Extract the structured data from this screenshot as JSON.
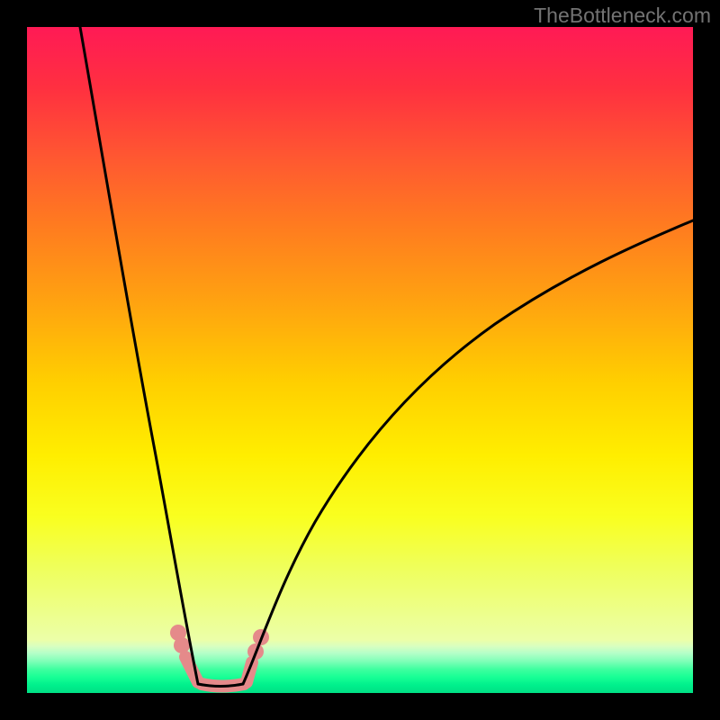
{
  "watermark": "TheBottleneck.com",
  "chart_data": {
    "type": "line",
    "title": "",
    "xlabel": "",
    "ylabel": "",
    "xlim": [
      0,
      100
    ],
    "ylim": [
      0,
      100
    ],
    "grid": false,
    "series": [
      {
        "name": "left-curve",
        "x": [
          8,
          10,
          12,
          14,
          16,
          18,
          20,
          21.5,
          23,
          24.5,
          25.7
        ],
        "y": [
          100,
          90,
          77,
          63,
          49,
          36,
          24,
          15,
          8,
          3,
          0
        ]
      },
      {
        "name": "right-curve",
        "x": [
          32.5,
          34,
          36,
          39,
          43,
          48,
          54,
          61,
          70,
          80,
          92,
          100
        ],
        "y": [
          0,
          3,
          8,
          15,
          24,
          33,
          42,
          50,
          57,
          63,
          68.5,
          71
        ]
      },
      {
        "name": "floor",
        "x": [
          25.7,
          28,
          30,
          32.5
        ],
        "y": [
          0,
          -0.2,
          -0.2,
          0
        ]
      }
    ],
    "markers": {
      "left": {
        "x_range": [
          22.8,
          25.6
        ],
        "y_range": [
          0.2,
          8.8
        ]
      },
      "right": {
        "x_range": [
          32.5,
          35.5
        ],
        "y_range": [
          0.2,
          7.0
        ]
      },
      "bottom": {
        "x_range": [
          26.0,
          33.3
        ]
      }
    },
    "background_gradient": {
      "top_color": "#ff1a55",
      "mid_colors": [
        "#ff7a20",
        "#ffee00"
      ],
      "bottom_color": "#00e085"
    }
  }
}
